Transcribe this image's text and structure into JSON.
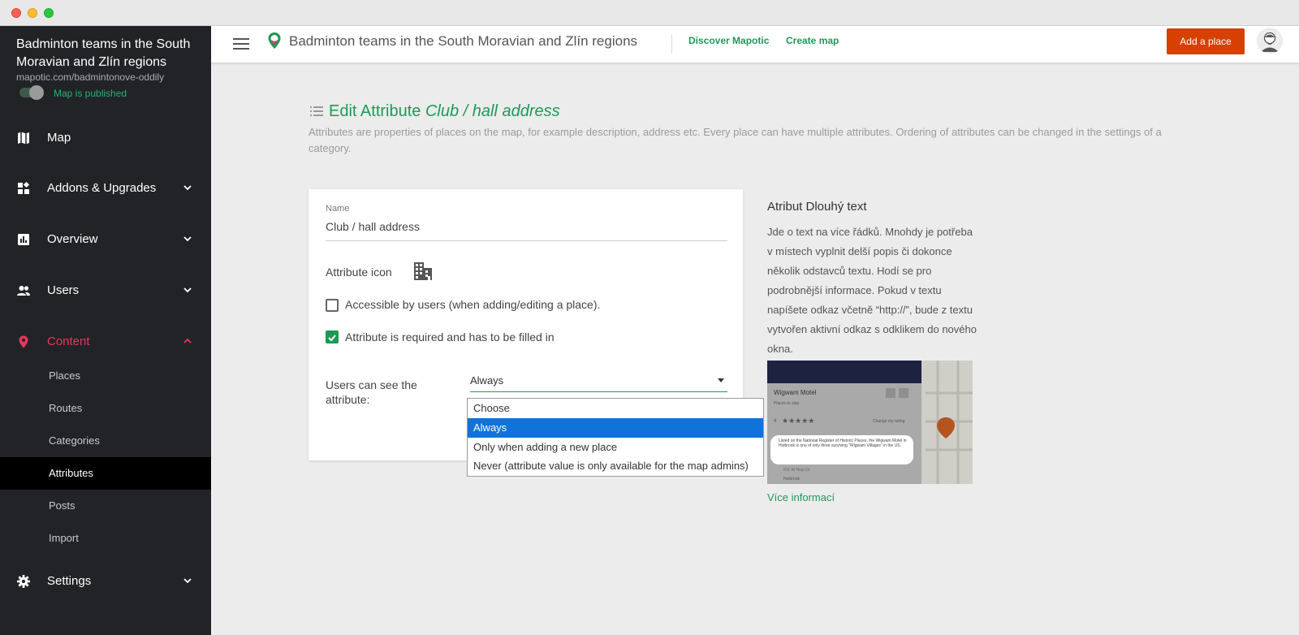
{
  "sidebar": {
    "map_title": "Badminton teams in the South Moravian and Zlín regions",
    "map_url": "mapotic.com/badmintonove-oddily",
    "published_label": "Map is published",
    "nav": {
      "map": "Map",
      "addons": "Addons & Upgrades",
      "overview": "Overview",
      "users": "Users",
      "content": "Content",
      "settings": "Settings"
    },
    "content_items": [
      "Places",
      "Routes",
      "Categories",
      "Attributes",
      "Posts",
      "Import"
    ],
    "active_nav_color": "#e8365d"
  },
  "topbar": {
    "title": "Badminton teams in the South Moravian and Zlín regions",
    "discover": "Discover Mapotic",
    "create": "Create map",
    "add_place": "Add a place",
    "accent": "#1d9a55",
    "button_color": "#d64000"
  },
  "page": {
    "heading_prefix": "Edit Attribute",
    "heading_name": "Club / hall address",
    "description": "Attributes are properties of places on the map, for example description, address etc. Every place can have multiple attributes. Ordering of attributes can be changed in the settings of a category."
  },
  "form": {
    "name_label": "Name",
    "name_value": "Club / hall address",
    "icon_label": "Attribute icon",
    "icon_name": "building-icon",
    "accessible_label": "Accessible by users (when adding/editing a place).",
    "accessible_checked": false,
    "required_label": "Attribute is required and has to be filled in",
    "required_checked": true,
    "visibility_label": "Users can see the attribute:",
    "visibility_value": "Always",
    "visibility_options": [
      "Choose",
      "Always",
      "Only when adding a new place",
      "Never (attribute value is only available for the map admins)"
    ]
  },
  "info": {
    "title": "Atribut Dlouhý text",
    "text": "Jde o text na více řádků. Mnohdy je potřeba v místech vyplnit delší popis či dokonce několik odstavců textu. Hodí se pro podrobnější informace. Pokud v textu napíšete odkaz včetně “http://”, bude z textu vytvořen aktivní odkaz s odklikem do nového okna.",
    "more_link": "Více informací",
    "preview": {
      "place_name": "Wigwam Motel",
      "place_sub": "Places to stay",
      "rating": "4",
      "rating_action": "Change my rating",
      "long_text": "Listed on the National Register of Historic Places, the Wigwam Motel in Holbrook is one of only three surviving \"Wigwam Villages\" in the US.",
      "addr1": "811 W Hopi Dr",
      "addr2": "Holbrook"
    }
  }
}
